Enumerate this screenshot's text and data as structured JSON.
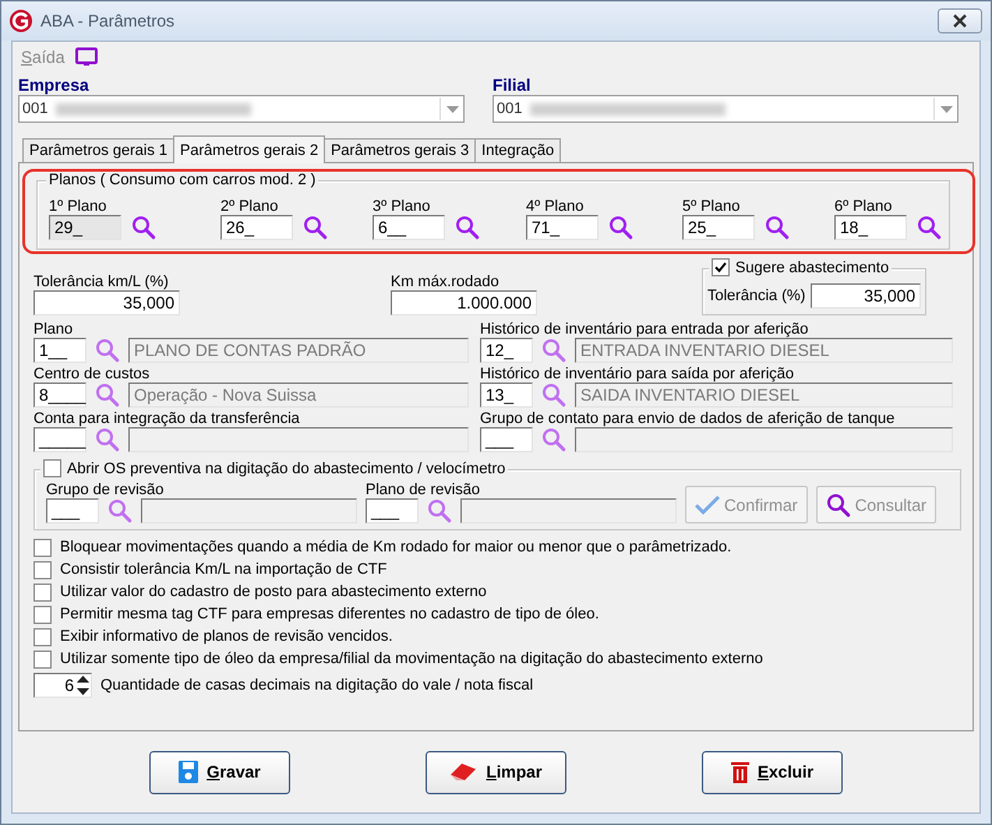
{
  "window": {
    "title": "ABA - Parâmetros"
  },
  "menu": [
    {
      "label": "Saída"
    }
  ],
  "empresa": {
    "label": "Empresa",
    "value": "001"
  },
  "filial": {
    "label": "Filial",
    "value": "001"
  },
  "tabs": [
    {
      "label": "Parâmetros gerais 1",
      "selected": false
    },
    {
      "label": "Parâmetros gerais 2",
      "selected": true
    },
    {
      "label": "Parâmetros gerais 3",
      "selected": false
    },
    {
      "label": "Integração",
      "selected": false
    }
  ],
  "planos": {
    "title": "Planos ( Consumo com carros mod. 2 )",
    "highlighted": true,
    "items": [
      {
        "label": "1º Plano",
        "value": "29_",
        "disabled": true
      },
      {
        "label": "2º Plano",
        "value": "26_",
        "disabled": false
      },
      {
        "label": "3º Plano",
        "value": "6__",
        "disabled": false
      },
      {
        "label": "4º Plano",
        "value": "71_",
        "disabled": false
      },
      {
        "label": "5º Plano",
        "value": "25_",
        "disabled": false
      },
      {
        "label": "6º Plano",
        "value": "18_",
        "disabled": false
      }
    ]
  },
  "tolerancia": {
    "label": "Tolerância km/L (%)",
    "value": "35,000"
  },
  "km_max": {
    "label": "Km máx.rodado",
    "value": "1.000.000"
  },
  "sugere": {
    "label": "Sugere abastecimento",
    "checked": true,
    "tolerance_label": "Tolerância (%)",
    "tolerance_value": "35,000"
  },
  "lookups": [
    {
      "label": "Plano",
      "code": "1__",
      "description": "PLANO DE CONTAS PADRÃO"
    },
    {
      "label": "Histórico de inventário para entrada por aferição",
      "code": "12_",
      "description": "ENTRADA INVENTARIO DIESEL"
    },
    {
      "label": "Centro de custos",
      "code": "8____",
      "description": "Operação - Nova Suissa"
    },
    {
      "label": "Histórico de inventário para saída por aferição",
      "code": "13_",
      "description": "SAIDA INVENTARIO DIESEL"
    },
    {
      "label": "Conta para integração da transferência",
      "code": "_____"
    },
    {
      "label": "Grupo de contato para envio de dados de aferição de tanque",
      "code": "___"
    }
  ],
  "os_group": {
    "label": "Abrir OS preventiva na digitação do abastecimento / velocímetro",
    "checked": false,
    "lookups": [
      {
        "label": "Grupo de revisão",
        "code": "___"
      },
      {
        "label": "Plano de revisão",
        "code": "___"
      }
    ],
    "buttons": [
      {
        "label": "Confirmar",
        "kind": "confirm",
        "disabled": true
      },
      {
        "label": "Consultar",
        "kind": "search",
        "disabled": false
      }
    ]
  },
  "options": [
    {
      "label": "Bloquear movimentações quando a média de Km rodado for maior ou menor que o parâmetrizado.",
      "checked": false
    },
    {
      "label": "Consistir tolerância Km/L na importação de CTF",
      "checked": false
    },
    {
      "label": "Utilizar valor do cadastro de posto para abastecimento externo",
      "checked": false
    },
    {
      "label": "Permitir mesma tag CTF para empresas diferentes no cadastro de tipo de óleo.",
      "checked": false
    },
    {
      "label": "Exibir informativo de planos de revisão vencidos.",
      "checked": false
    },
    {
      "label": "Utilizar somente tipo de óleo da empresa/filial da movimentação na digitação do abastecimento externo",
      "checked": false
    }
  ],
  "decimals": {
    "value": "6",
    "label": "Quantidade de casas decimais na digitação do vale / nota fiscal"
  },
  "actions": [
    {
      "label": "Gravar",
      "kind": "save"
    },
    {
      "label": "Limpar",
      "kind": "clear"
    },
    {
      "label": "Excluir",
      "kind": "delete"
    }
  ]
}
